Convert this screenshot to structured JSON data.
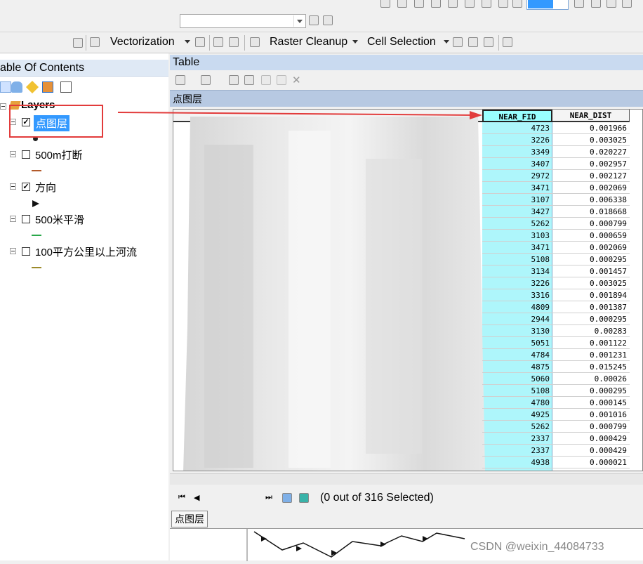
{
  "toolbar": {
    "vectorization_label": "Vectorization",
    "raster_cleanup_label": "Raster Cleanup",
    "cell_selection_label": "Cell Selection"
  },
  "toc": {
    "title": "able Of Contents",
    "root_label": "Layers",
    "layers": [
      {
        "name": "点图层",
        "checked": true,
        "selected": true
      },
      {
        "name": "500m打断",
        "checked": false
      },
      {
        "name": "方向",
        "checked": true
      },
      {
        "name": "500米平滑",
        "checked": false
      },
      {
        "name": "100平方公里以上河流",
        "checked": false
      }
    ]
  },
  "table": {
    "window_title": "Table",
    "layer_tab": "点图层",
    "columns": [
      "NEAR_FID",
      "NEAR_DIST"
    ],
    "rows": [
      [
        "4723",
        "0.001966"
      ],
      [
        "3226",
        "0.003025"
      ],
      [
        "3349",
        "0.020227"
      ],
      [
        "3407",
        "0.002957"
      ],
      [
        "2972",
        "0.002127"
      ],
      [
        "3471",
        "0.002069"
      ],
      [
        "3107",
        "0.006338"
      ],
      [
        "3427",
        "0.018668"
      ],
      [
        "5262",
        "0.000799"
      ],
      [
        "3103",
        "0.000659"
      ],
      [
        "3471",
        "0.002069"
      ],
      [
        "5108",
        "0.000295"
      ],
      [
        "3134",
        "0.001457"
      ],
      [
        "3226",
        "0.003025"
      ],
      [
        "3316",
        "0.001894"
      ],
      [
        "4809",
        "0.001387"
      ],
      [
        "2944",
        "0.000295"
      ],
      [
        "3130",
        "0.00283"
      ],
      [
        "5051",
        "0.001122"
      ],
      [
        "4784",
        "0.001231"
      ],
      [
        "4875",
        "0.015245"
      ],
      [
        "5060",
        "0.00026"
      ],
      [
        "5108",
        "0.000295"
      ],
      [
        "4780",
        "0.000145"
      ],
      [
        "4925",
        "0.001016"
      ],
      [
        "5262",
        "0.000799"
      ],
      [
        "2337",
        "0.000429"
      ],
      [
        "2337",
        "0.000429"
      ],
      [
        "4938",
        "0.000021"
      ]
    ],
    "selection_status": "(0 out of 316 Selected)",
    "bottom_tab": "点图层"
  },
  "watermark": "CSDN @weixin_44084733",
  "colors": {
    "annotation_red": "#e23b3b",
    "selected_column": "#aef6fb",
    "toc_selected": "#3399ff"
  }
}
